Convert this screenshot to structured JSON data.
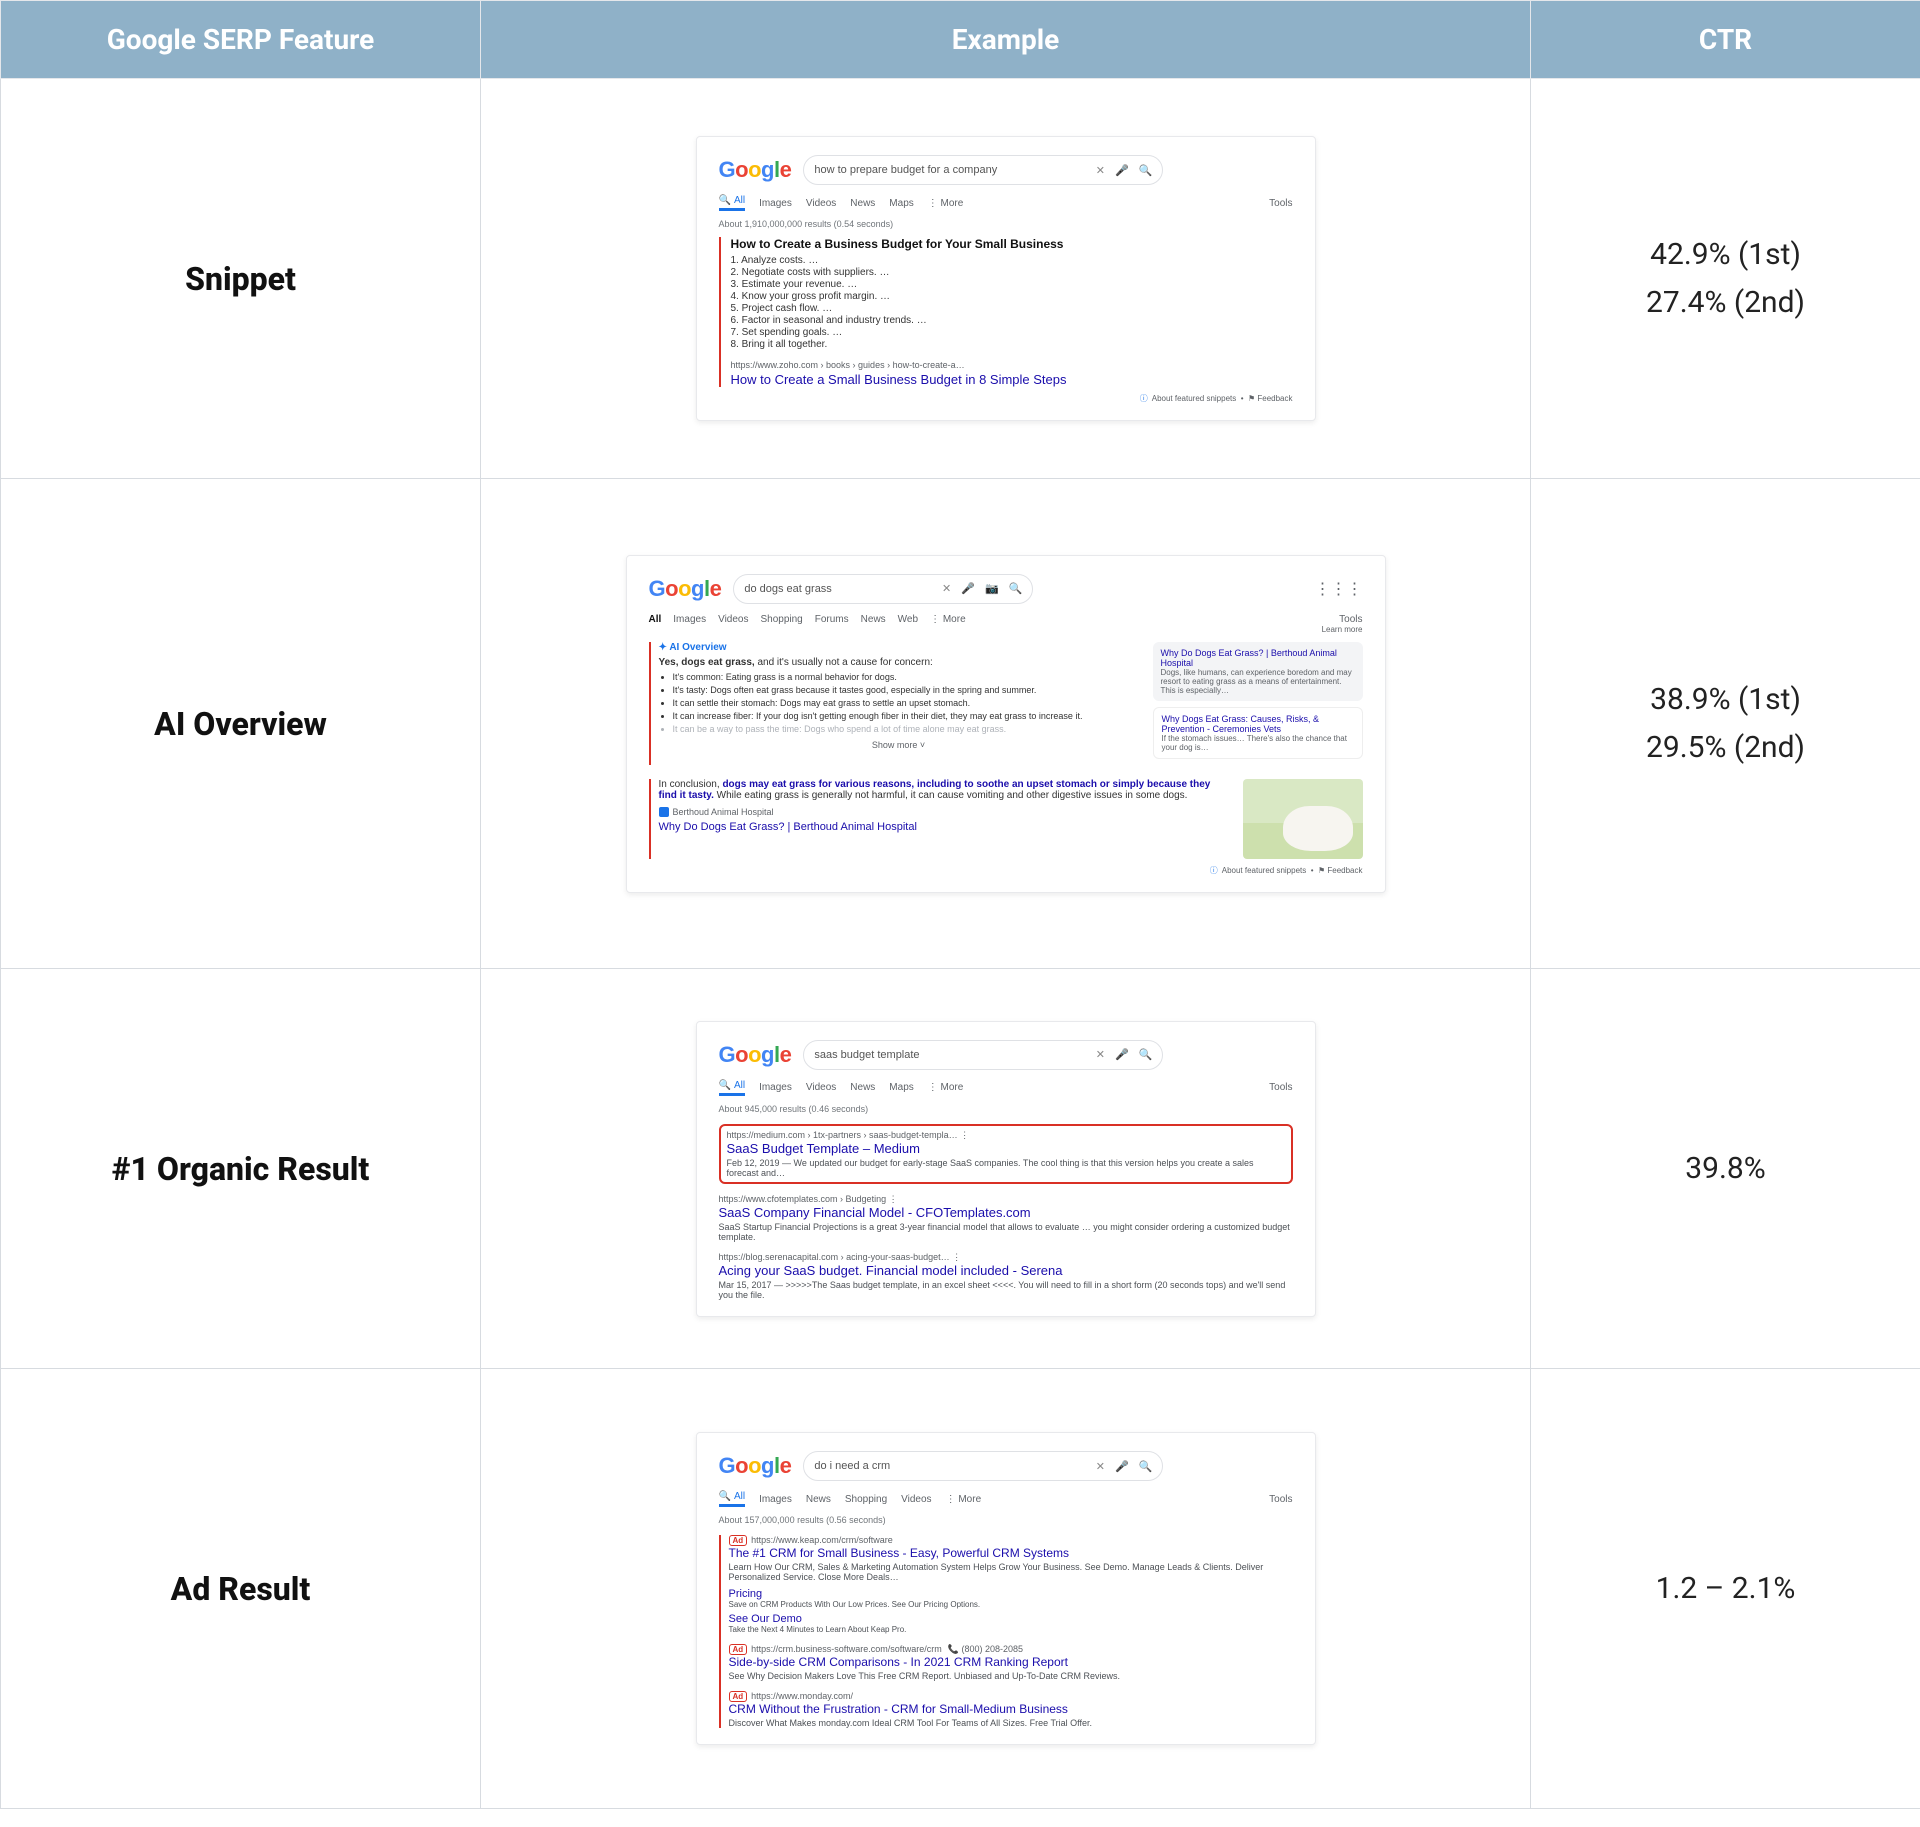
{
  "chart_data": {
    "type": "table",
    "columns": [
      "Google SERP Feature",
      "CTR"
    ],
    "rows": [
      {
        "feature": "Snippet",
        "ctr": [
          "42.9% (1st)",
          "27.4% (2nd)"
        ]
      },
      {
        "feature": "AI Overview",
        "ctr": [
          "38.9% (1st)",
          "29.5% (2nd)"
        ]
      },
      {
        "feature": "#1 Organic Result",
        "ctr": [
          "39.8%"
        ]
      },
      {
        "feature": "Ad Result",
        "ctr": [
          "1.2 – 2.1%"
        ]
      }
    ]
  },
  "headers": {
    "feature": "Google SERP Feature",
    "example": "Example",
    "ctr": "CTR"
  },
  "rows": {
    "snippet": {
      "label": "Snippet",
      "ctr1": "42.9% (1st)",
      "ctr2": "27.4% (2nd)",
      "shot": {
        "query": "how to prepare budget for a company",
        "tabs": {
          "all": "All",
          "images": "Images",
          "videos": "Videos",
          "news": "News",
          "maps": "Maps",
          "more": "More",
          "tools": "Tools"
        },
        "about": "About 1,910,000,000 results (0.54 seconds)",
        "title": "How to Create a Business Budget for Your Small Business",
        "list": {
          "i1": "1. Analyze costs. …",
          "i2": "2. Negotiate costs with suppliers. …",
          "i3": "3. Estimate your revenue. …",
          "i4": "4. Know your gross profit margin. …",
          "i5": "5. Project cash flow. …",
          "i6": "6. Factor in seasonal and industry trends. …",
          "i7": "7. Set spending goals. …",
          "i8": "8. Bring it all together."
        },
        "crumb": "https://www.zoho.com › books › guides › how-to-create-a…",
        "link": "How to Create a Small Business Budget in 8 Simple Steps",
        "fb1": "About featured snippets",
        "fb2": "Feedback"
      }
    },
    "ai": {
      "label": "AI Overview",
      "ctr1": "38.9% (1st)",
      "ctr2": "29.5% (2nd)",
      "shot": {
        "query": "do dogs eat grass",
        "tabs": {
          "all": "All",
          "images": "Images",
          "videos": "Videos",
          "shopping": "Shopping",
          "forums": "Forums",
          "news": "News",
          "web": "Web",
          "more": "More",
          "tools": "Tools"
        },
        "learn": "Learn more",
        "ov_label": "AI Overview",
        "lead_bold": "Yes, dogs eat grass,",
        "lead_rest": " and it's usually not a cause for concern:",
        "b1": "It's common: Eating grass is a normal behavior for dogs.",
        "b2": "It's tasty: Dogs often eat grass because it tastes good, especially in the spring and summer.",
        "b3": "It can settle their stomach: Dogs may eat grass to settle an upset stomach.",
        "b4": "It can increase fiber: If your dog isn't getting enough fiber in their diet, they may eat grass to increase it.",
        "b5": "It can be a way to pass the time: Dogs who spend a lot of time alone may eat grass.",
        "show_more": "Show more",
        "src1_title": "Why Do Dogs Eat Grass? | Berthoud Animal Hospital",
        "src1_desc": "Dogs, like humans, can experience boredom and may resort to eating grass as a means of entertainment. This is especially…",
        "src2_title": "Why Dogs Eat Grass: Causes, Risks, & Prevention - Ceremonies Vets",
        "src2_desc": "If the stomach issues… There's also the chance that your dog is…",
        "con_lead": "In conclusion, ",
        "con_bold": "dogs may eat grass for various reasons, including to soothe an upset stomach or simply because they find it tasty.",
        "con_rest": " While eating grass is generally not harmful, it can cause vomiting and other digestive issues in some dogs.",
        "badge_site": "Berthoud Animal Hospital",
        "bl_link": "Why Do Dogs Eat Grass? | Berthoud Animal Hospital",
        "fb1": "About featured snippets",
        "fb2": "Feedback"
      }
    },
    "organic": {
      "label": "#1 Organic Result",
      "ctr1": "39.8%",
      "shot": {
        "query": "saas budget template",
        "tabs": {
          "all": "All",
          "images": "Images",
          "videos": "Videos",
          "news": "News",
          "maps": "Maps",
          "more": "More",
          "tools": "Tools"
        },
        "about": "About 945,000 results (0.46 seconds)",
        "r1_url": "https://medium.com › 1tx-partners › saas-budget-templa…   ⋮",
        "r1_title": "SaaS Budget Template – Medium",
        "r1_desc": "Feb 12, 2019 — We updated our budget for early-stage SaaS companies. The cool thing is that this version helps you create a sales forecast and…",
        "r2_url": "https://www.cfotemplates.com › Budgeting   ⋮",
        "r2_title": "SaaS Company Financial Model - CFOTemplates.com",
        "r2_desc": "SaaS Startup Financial Projections is a great 3-year financial model that allows to evaluate … you might consider ordering a customized budget template.",
        "r3_url": "https://blog.serenacapital.com › acing-your-saas-budget…   ⋮",
        "r3_title": "Acing your SaaS budget. Financial model included - Serena",
        "r3_desc": "Mar 15, 2017 — >>>>>The Saas budget template, in an excel sheet <<<<. You will need to fill in a short form (20 seconds tops) and we'll send you the file."
      }
    },
    "ad": {
      "label": "Ad Result",
      "ctr1": "1.2 – 2.1%",
      "shot": {
        "query": "do i need a crm",
        "tabs": {
          "all": "All",
          "images": "Images",
          "news": "News",
          "shopping": "Shopping",
          "videos": "Videos",
          "more": "More",
          "tools": "Tools"
        },
        "about": "About 157,000,000 results (0.56 seconds)",
        "ad_label": "Ad",
        "a1_url": "https://www.keap.com/crm/software",
        "a1_title": "The #1 CRM for Small Business - Easy, Powerful CRM Systems",
        "a1_desc": "Learn How Our CRM, Sales & Marketing Automation System Helps Grow Your Business. See Demo. Manage Leads & Clients. Deliver Personalized Service. Close More Deals…",
        "a1_sl1_t": "Pricing",
        "a1_sl1_d": "Save on CRM Products With Our Low Prices. See Our Pricing Options.",
        "a1_sl2_t": "See Our Demo",
        "a1_sl2_d": "Take the Next 4 Minutes to Learn About Keap Pro.",
        "a2_url": "https://crm.business-software.com/software/crm",
        "a2_phone": "(800) 208-2085",
        "a2_title": "Side-by-side CRM Comparisons - In 2021 CRM Ranking Report",
        "a2_desc": "See Why Decision Makers Love This Free CRM Report. Unbiased and Up-To-Date CRM Reviews.",
        "a3_url": "https://www.monday.com/",
        "a3_title": "CRM Without the Frustration - CRM for Small-Medium Business",
        "a3_desc": "Discover What Makes monday.com Ideal CRM Tool For Teams of All Sizes. Free Trial Offer."
      }
    }
  }
}
